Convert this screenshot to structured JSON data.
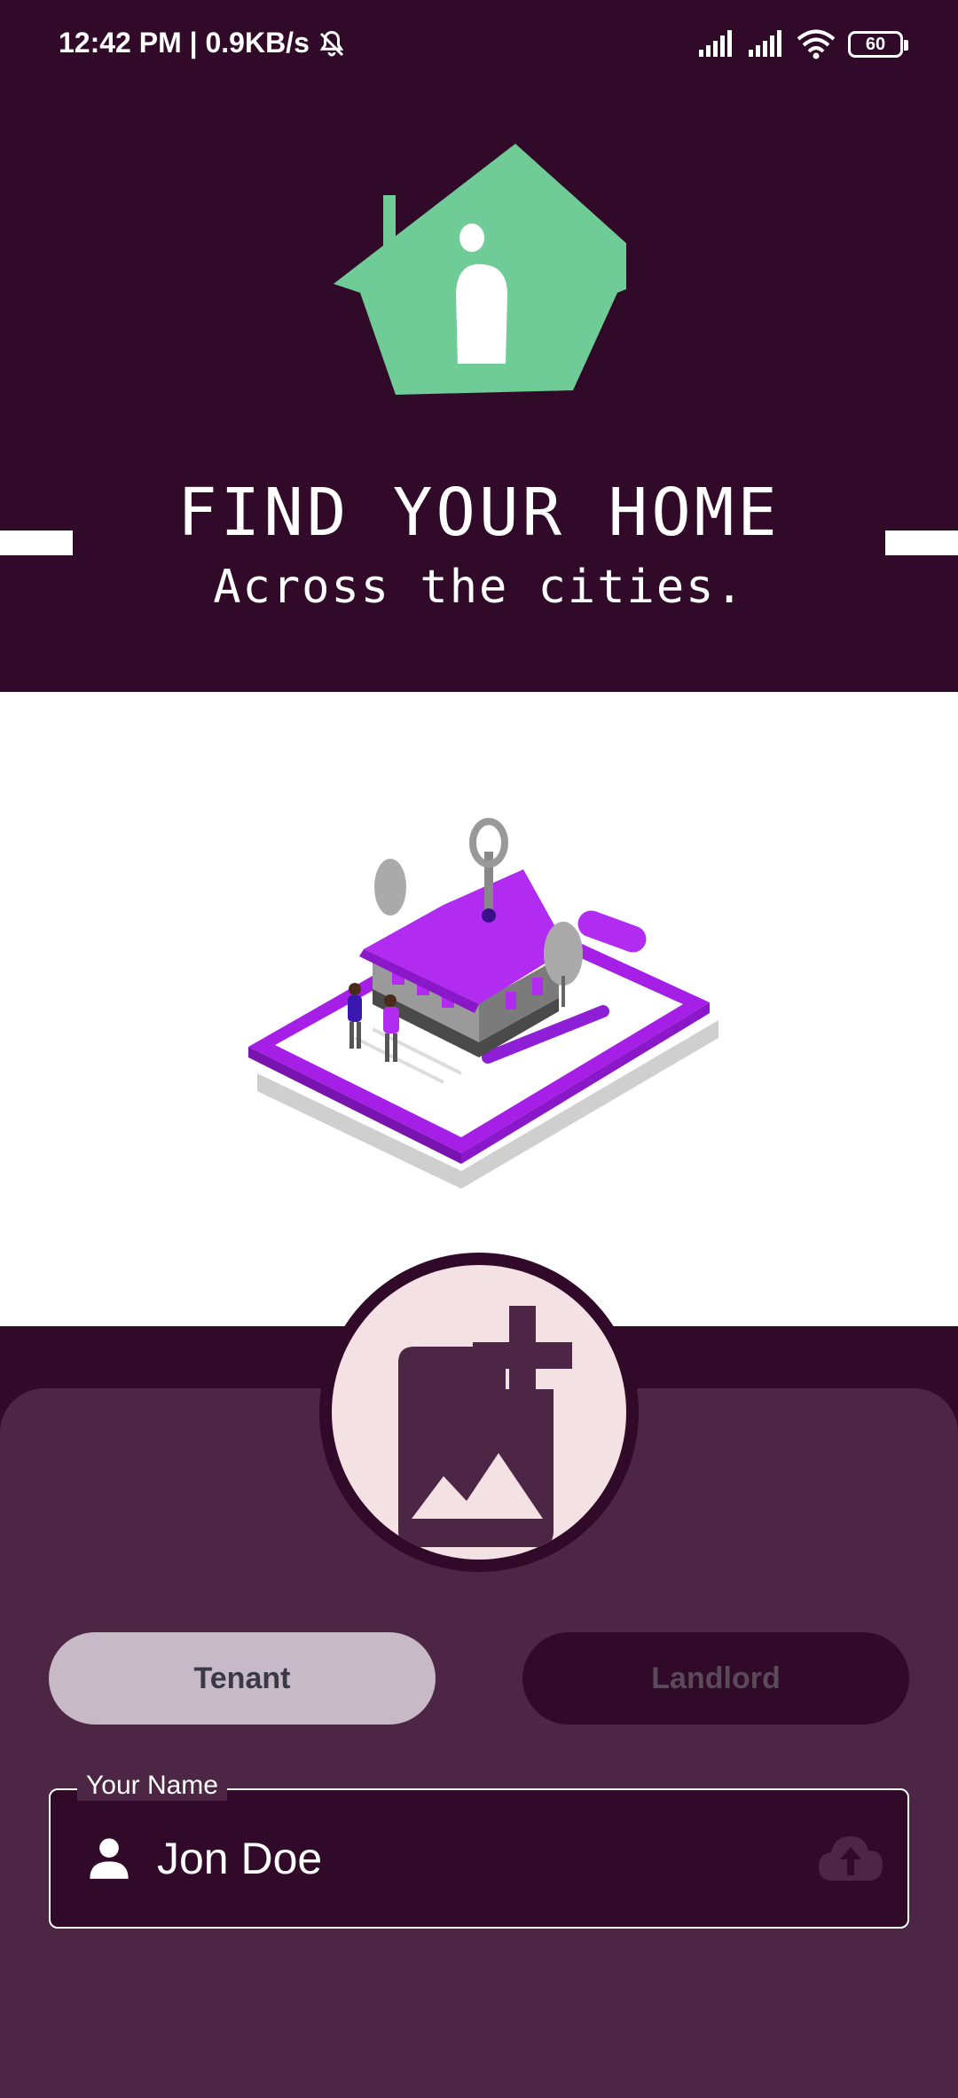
{
  "status_bar": {
    "time_speed": "12:42 PM | 0.9KB/s",
    "battery": "60",
    "icons": [
      "mute-bell-icon",
      "signal-icon",
      "signal-icon",
      "wifi-icon",
      "battery-icon"
    ]
  },
  "header": {
    "logo_icon": "house-icon",
    "title": "FIND YOUR HOME",
    "subtitle": "Across the cities."
  },
  "hero": {
    "illustration": "isometric-house-illustration"
  },
  "profile": {
    "avatar_icon": "add-photo-icon"
  },
  "role_toggle": {
    "tenant_label": "Tenant",
    "landlord_label": "Landlord",
    "selected": "Tenant"
  },
  "name_field": {
    "label": "Your Name",
    "value": "Jon Doe",
    "leading_icon": "person-icon",
    "trailing_icon": "cloud-upload-icon"
  },
  "colors": {
    "primary_dark": "#300a28",
    "card": "#4e2645",
    "accent_green": "#6fcc96",
    "avatar_bg": "#f3e1e3",
    "illustration_purple": "#b22bf0"
  }
}
